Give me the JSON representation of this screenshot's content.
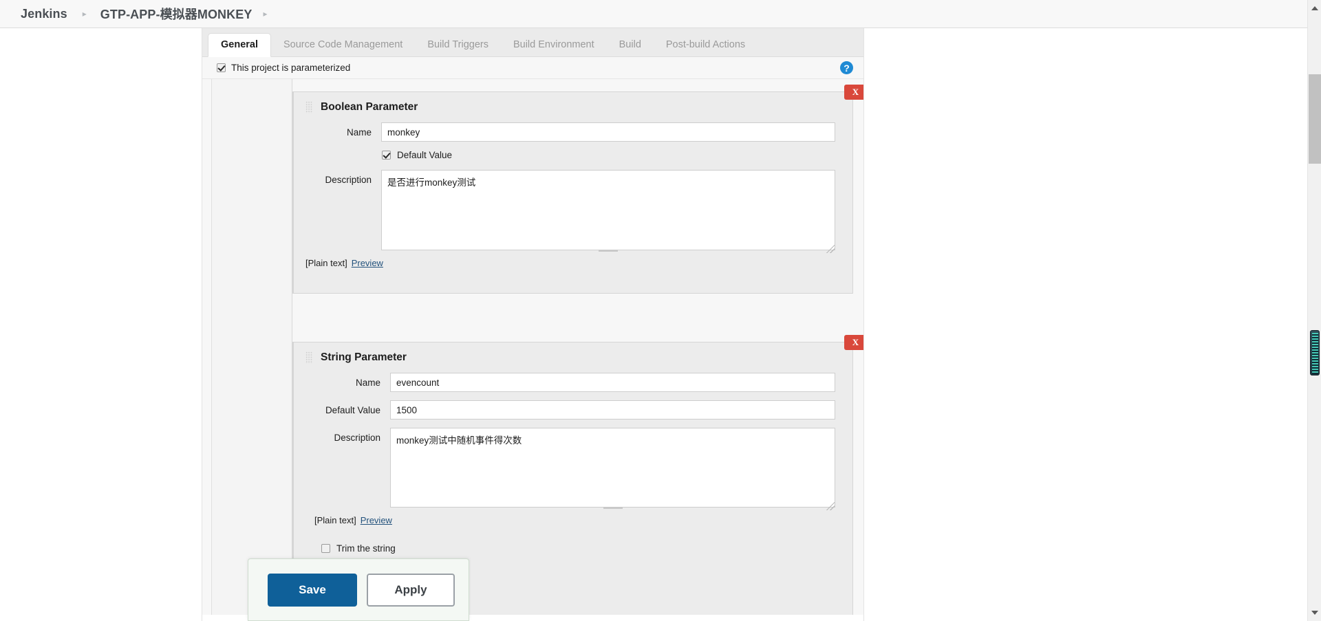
{
  "breadcrumb": {
    "items": [
      {
        "label": "Jenkins"
      },
      {
        "label": "GTP-APP-模拟器MONKEY"
      }
    ],
    "separator": "▸"
  },
  "tabs": [
    {
      "label": "General",
      "active": true
    },
    {
      "label": "Source Code Management",
      "active": false
    },
    {
      "label": "Build Triggers",
      "active": false
    },
    {
      "label": "Build Environment",
      "active": false
    },
    {
      "label": "Build",
      "active": false
    },
    {
      "label": "Post-build Actions",
      "active": false
    }
  ],
  "parameterized": {
    "label": "This project is parameterized",
    "checked": true
  },
  "boolean_parameter": {
    "title": "Boolean Parameter",
    "delete_label": "X",
    "name_label": "Name",
    "name_value": "monkey",
    "default_value_label": "Default Value",
    "default_value_checked": true,
    "description_label": "Description",
    "description_value": "是否进行monkey测试",
    "plain_text_label": "[Plain text]",
    "preview_label": "Preview"
  },
  "string_parameter": {
    "title": "String Parameter",
    "delete_label": "X",
    "name_label": "Name",
    "name_value": "evencount",
    "default_value_label": "Default Value",
    "default_value": "1500",
    "description_label": "Description",
    "description_value": "monkey测试中随机事件得次数",
    "plain_text_label": "[Plain text]",
    "preview_label": "Preview",
    "trim_label": "Trim the string",
    "trim_checked": false
  },
  "help_icon": "?",
  "actions": {
    "save_label": "Save",
    "apply_label": "Apply"
  },
  "colors": {
    "save_blue": "#0f6099",
    "delete_red": "#d9483b",
    "help_blue": "#1f8ad4",
    "link_blue": "#23527c"
  }
}
